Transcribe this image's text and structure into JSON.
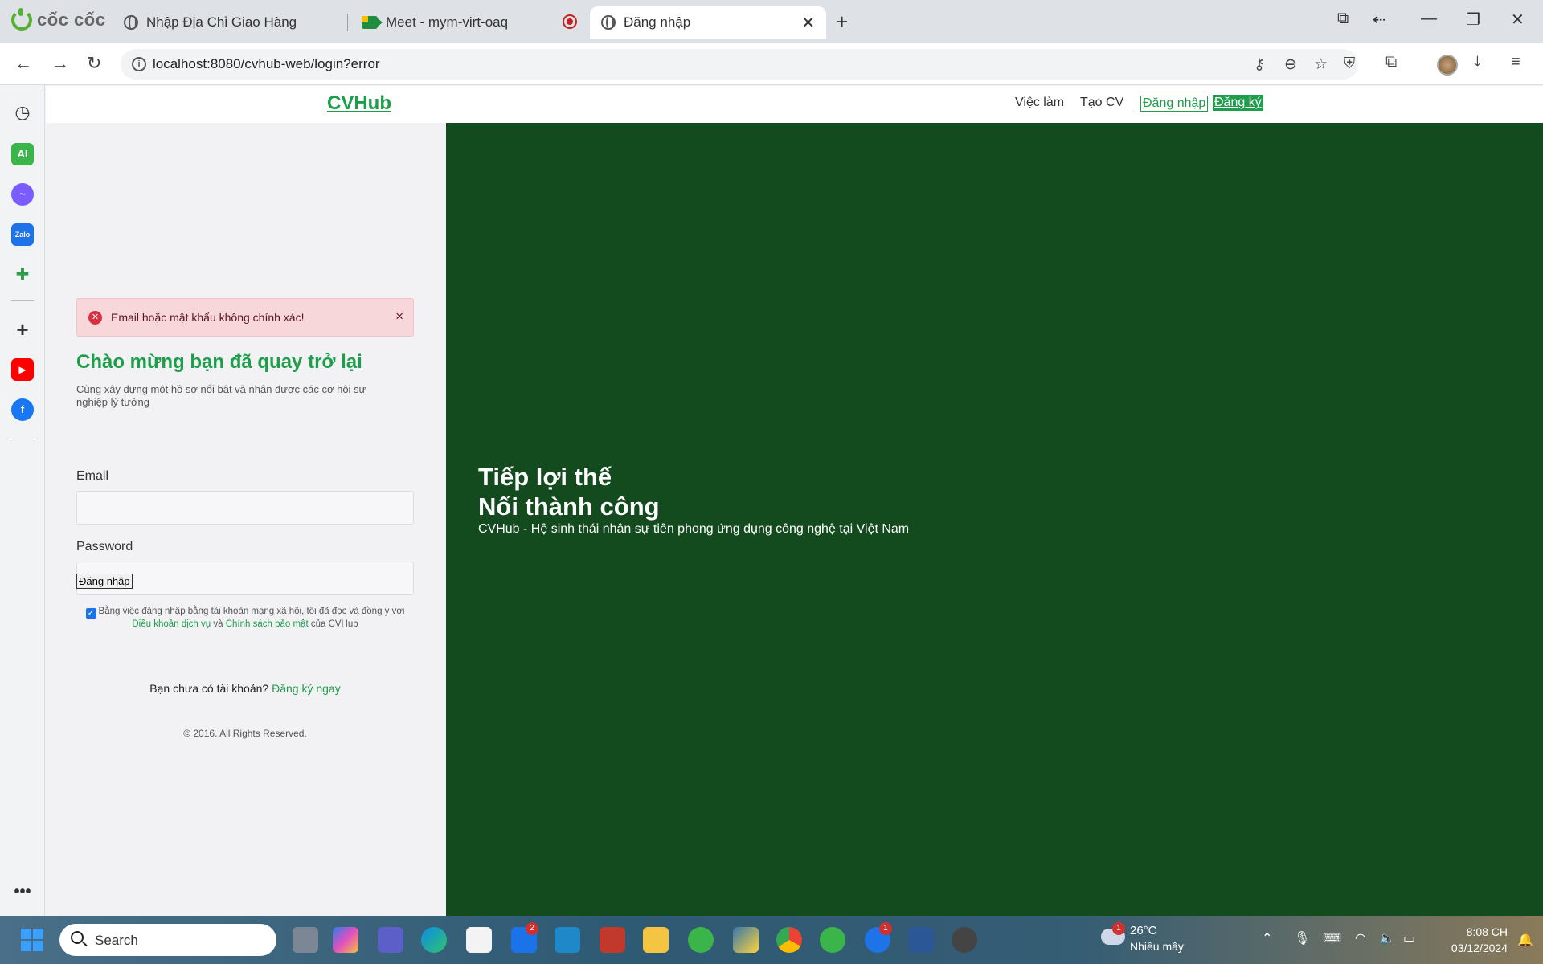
{
  "browser": {
    "brand": "cốc cốc",
    "tabs": [
      {
        "title": "Nhập Địa Chỉ Giao Hàng"
      },
      {
        "title": "Meet - mym-virt-oaq"
      },
      {
        "title": "Đăng nhập"
      }
    ],
    "url": "localhost:8080/cvhub-web/login?error"
  },
  "site": {
    "logo": "CVHub",
    "nav": {
      "jobs": "Việc làm",
      "create_cv": "Tạo CV",
      "login": "Đăng nhập",
      "register": "Đăng ký"
    }
  },
  "login": {
    "alert": "Email hoặc mật khẩu không chính xác!",
    "heading": "Chào mừng bạn đã quay trở lại",
    "subheading": "Cùng xây dựng một hồ sơ nổi bật và nhận được các cơ hội sự nghiệp lý tưởng",
    "email_label": "Email",
    "password_label": "Password",
    "email_value": "",
    "password_value": "",
    "submit": "Đăng nhập",
    "terms_prefix": "Bằng việc đăng nhập bằng tài khoản mạng xã hội, tôi đã đọc và đồng ý với",
    "terms_link": "Điều khoản dịch vụ",
    "terms_and": "và",
    "privacy_link": "Chính sách bảo mật",
    "terms_suffix": "của CVHub",
    "no_account": "Bạn chưa có tài khoản?",
    "signup_link": "Đăng ký ngay",
    "copyright": "© 2016. All Rights Reserved."
  },
  "hero": {
    "line1": "Tiếp lợi thế",
    "line2": "Nối thành công",
    "subtitle": "CVHub - Hệ sinh thái nhân sự tiên phong ứng dụng công nghệ tại Việt Nam"
  },
  "taskbar": {
    "search": "Search",
    "mail_badge": "2",
    "zalo_badge": "1",
    "weather_badge": "1",
    "temperature": "26°C",
    "weather_desc": "Nhiều mây",
    "time": "8:08 CH",
    "date": "03/12/2024"
  },
  "colors": {
    "brand_green": "#1e9e4a",
    "hero_bg": "#134a1e",
    "alert_bg": "#f8d7da"
  }
}
